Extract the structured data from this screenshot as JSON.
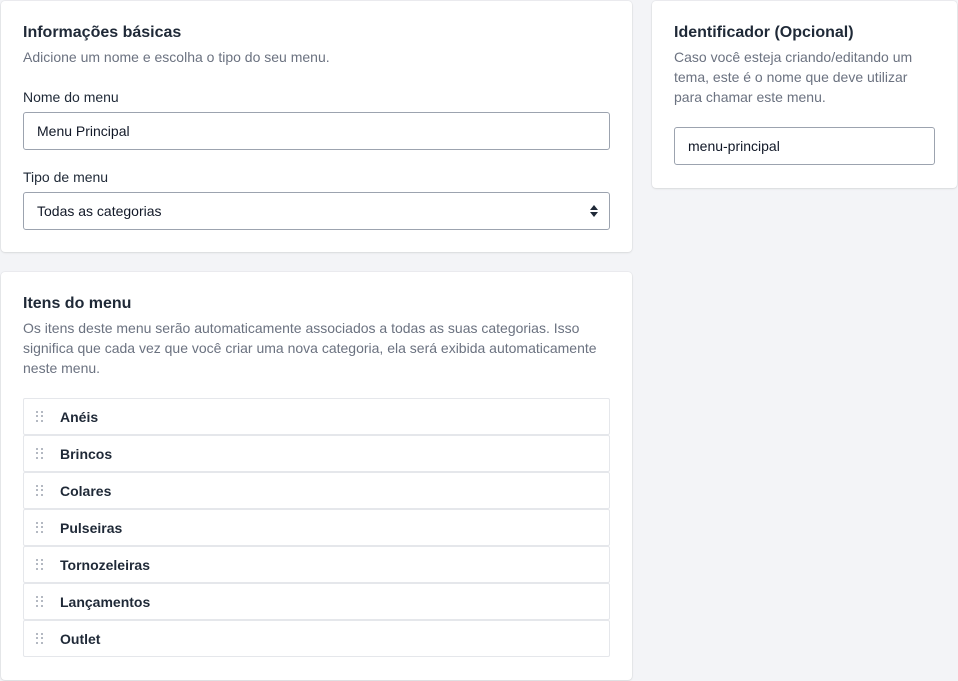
{
  "basic": {
    "title": "Informações básicas",
    "description": "Adicione um nome e escolha o tipo do seu menu.",
    "name_label": "Nome do menu",
    "name_value": "Menu Principal",
    "type_label": "Tipo de menu",
    "type_value": "Todas as categorias"
  },
  "identifier": {
    "title": "Identificador (Opcional)",
    "description": "Caso você esteja criando/editando um tema, este é o nome que deve utilizar para chamar este menu.",
    "value": "menu-principal"
  },
  "items": {
    "title": "Itens do menu",
    "description": "Os itens deste menu serão automaticamente associados a todas as suas categorias. Isso significa que cada vez que você criar uma nova categoria, ela será exibida automaticamente neste menu.",
    "list": [
      "Anéis",
      "Brincos",
      "Colares",
      "Pulseiras",
      "Tornozeleiras",
      "Lançamentos",
      "Outlet"
    ]
  },
  "icons": {
    "drag": "drag-handle-icon",
    "select": "select-arrows-icon"
  }
}
